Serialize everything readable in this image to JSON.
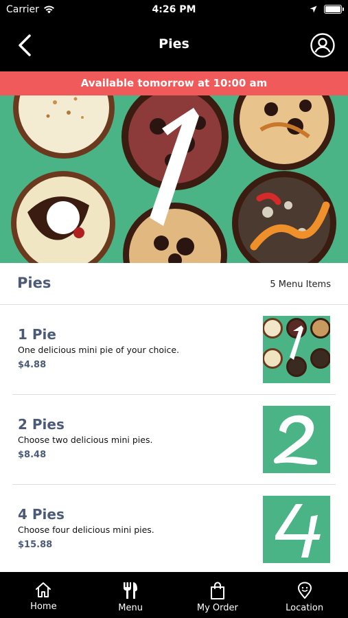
{
  "status": {
    "carrier": "Carrier",
    "time": "4:26 PM"
  },
  "nav": {
    "title": "Pies"
  },
  "banner": "Available tomorrow at 10:00 am",
  "section": {
    "name": "Pies",
    "count": "5 Menu Items"
  },
  "items": [
    {
      "name": "1 Pie",
      "description": "One delicious mini pie of your choice.",
      "price": "$4.88",
      "thumb_number": "1"
    },
    {
      "name": "2 Pies",
      "description": "Choose two delicious mini pies.",
      "price": "$8.48",
      "thumb_number": "2"
    },
    {
      "name": "4 Pies",
      "description": "Choose four delicious mini pies.",
      "price": "$15.88",
      "thumb_number": "4"
    }
  ],
  "tabs": [
    {
      "label": "Home",
      "icon": "home-icon"
    },
    {
      "label": "Menu",
      "icon": "utensils-icon"
    },
    {
      "label": "My Order",
      "icon": "bag-icon"
    },
    {
      "label": "Location",
      "icon": "location-pin-icon"
    }
  ],
  "colors": {
    "banner": "#f05a5a",
    "brand_green": "#4ab487",
    "title_text": "#4a5a78"
  }
}
